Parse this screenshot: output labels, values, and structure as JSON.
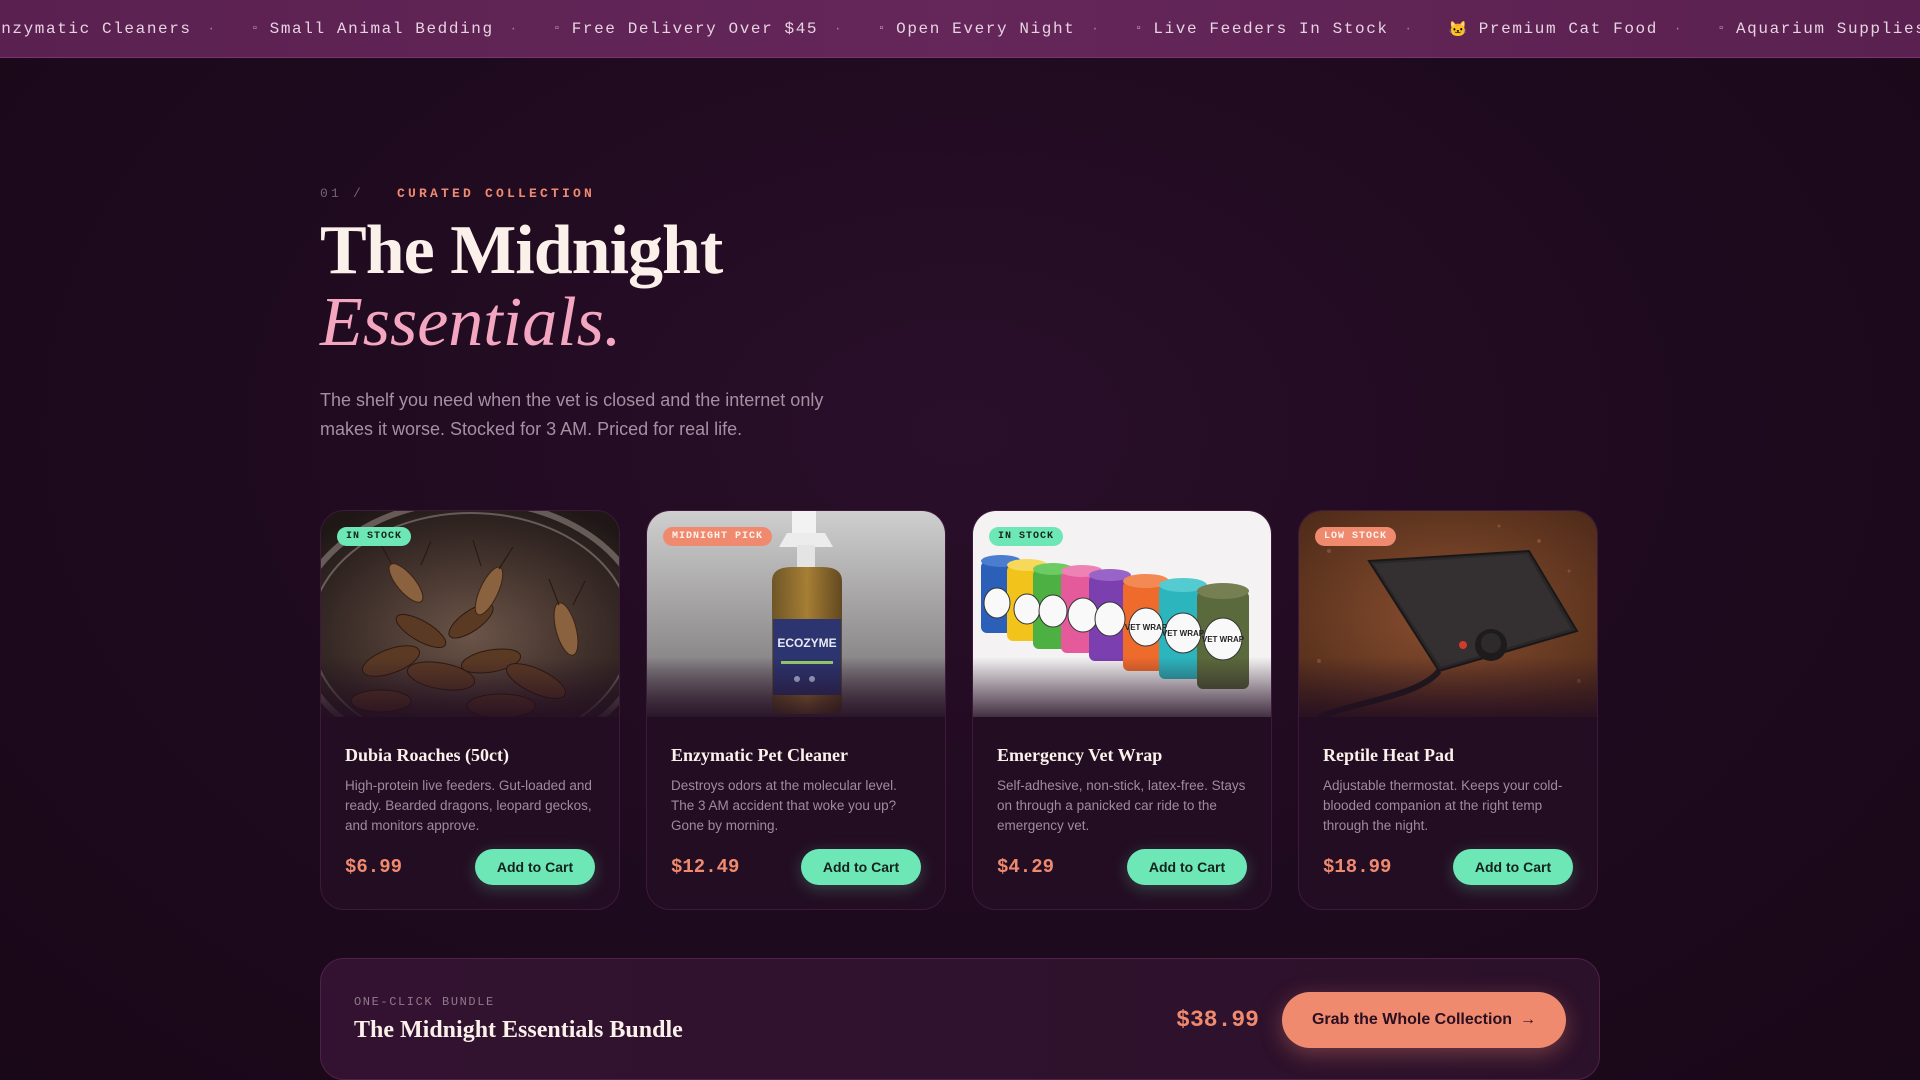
{
  "ticker": {
    "items": [
      {
        "icon": "",
        "label": "Enzymatic Cleaners",
        "separator": "·"
      },
      {
        "icon": "▫",
        "label": "Small Animal Bedding",
        "separator": "·"
      },
      {
        "icon": "▫",
        "label": "Free Delivery Over $45",
        "separator": "·"
      },
      {
        "icon": "▫",
        "label": "Open Every Night",
        "separator": "·"
      },
      {
        "icon": "▫",
        "label": "Live Feeders In Stock",
        "separator": "·"
      },
      {
        "icon": "🐱",
        "label": "Premium Cat Food",
        "separator": "·"
      },
      {
        "icon": "▫",
        "label": "Aquarium Supplies",
        "separator": "·"
      }
    ]
  },
  "section": {
    "number": "01 /",
    "eyebrow": "CURATED COLLECTION",
    "title": "The Midnight",
    "title_italic": "Essentials.",
    "lede": "The shelf you need when the vet is closed and the internet only makes it worse. Stocked for 3 AM. Priced for real life."
  },
  "products": [
    {
      "badge": "IN STOCK",
      "name": "Dubia Roaches (50ct)",
      "description": "High-protein live feeders. Gut-loaded and ready. Bearded dragons, leopard geckos, and monitors approve.",
      "price": "$6.99",
      "button": "Add to Cart"
    },
    {
      "badge": "MIDNIGHT PICK",
      "name": "Enzymatic Pet Cleaner",
      "description": "Destroys odors at the molecular level. The 3 AM accident that woke you up? Gone by morning.",
      "price": "$12.49",
      "button": "Add to Cart",
      "label_lines": [
        "ECOZYME"
      ]
    },
    {
      "badge": "IN STOCK",
      "name": "Emergency Vet Wrap",
      "description": "Self-adhesive, non-stick, latex-free. Stays on through a panicked car ride to the emergency vet.",
      "price": "$4.29",
      "button": "Add to Cart",
      "label_lines": [
        "VET WRAP"
      ]
    },
    {
      "badge": "LOW STOCK",
      "name": "Reptile Heat Pad",
      "description": "Adjustable thermostat. Keeps your cold-blooded companion at the right temp through the night.",
      "price": "$18.99",
      "button": "Add to Cart"
    }
  ],
  "bundle": {
    "eyebrow": "ONE-CLICK BUNDLE",
    "title": "The Midnight Essentials Bundle",
    "price": "$38.99",
    "button": "Grab the Whole Collection",
    "button_arrow": "→"
  },
  "colors": {
    "accent_orange": "#ef8a6f",
    "accent_green": "#6ee7b7",
    "accent_pink": "#f4a6c0",
    "ticker_bg": "#5a2150",
    "background": "#1e0a1e"
  }
}
